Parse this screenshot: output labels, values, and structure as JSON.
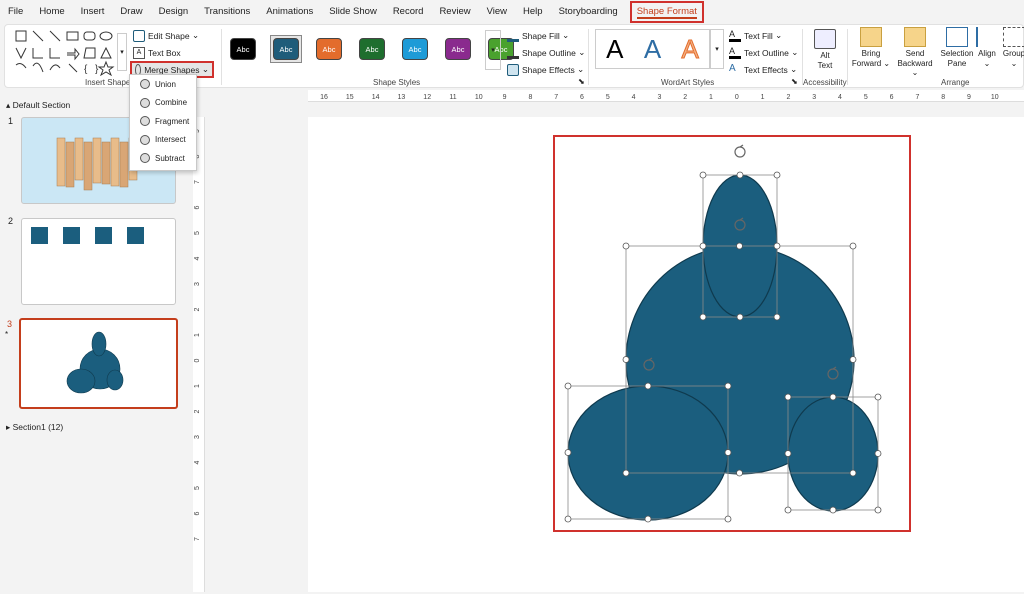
{
  "menu": [
    "File",
    "Home",
    "Insert",
    "Draw",
    "Design",
    "Transitions",
    "Animations",
    "Slide Show",
    "Record",
    "Review",
    "View",
    "Help",
    "Storyboarding",
    "Shape Format"
  ],
  "ribbon": {
    "insert_shapes_label": "Insert Shapes",
    "edit_shape": "Edit Shape",
    "text_box": "Text Box",
    "merge_shapes": "Merge Shapes",
    "shape_styles_label": "Shape Styles",
    "style_text": "Abc",
    "style_colors": [
      "#000000",
      "#1f5c7a",
      "#e36c2c",
      "#1e6e2e",
      "#1e9bd7",
      "#8a2a8e",
      "#4aa22e"
    ],
    "shape_fill": "Shape Fill",
    "shape_outline": "Shape Outline",
    "shape_effects": "Shape Effects",
    "wordart_label": "WordArt Styles",
    "wordart_glyph": "A",
    "text_fill": "Text Fill",
    "text_outline": "Text Outline",
    "text_effects": "Text Effects",
    "alt_text_1": "Alt",
    "alt_text_2": "Text",
    "accessibility_label": "Accessibility",
    "bring_forward_1": "Bring",
    "bring_forward_2": "Forward",
    "send_backward_1": "Send",
    "send_backward_2": "Backward",
    "selection_pane_1": "Selection",
    "selection_pane_2": "Pane",
    "align": "Align",
    "group": "Group",
    "arrange_label": "Arrange"
  },
  "merge_menu": [
    "Union",
    "Combine",
    "Fragment",
    "Intersect",
    "Subtract"
  ],
  "slides_pane": {
    "default_section": "Default Section",
    "section1": "Section1 (12)",
    "slide_numbers": [
      "1",
      "2",
      "3"
    ],
    "star": "*"
  },
  "ruler": {
    "h_ticks": [
      "16",
      "15",
      "14",
      "13",
      "12",
      "11",
      "10",
      "9",
      "8",
      "7",
      "6",
      "5",
      "4",
      "3",
      "2",
      "1",
      "0",
      "1",
      "2",
      "3",
      "4",
      "5",
      "6",
      "7",
      "8",
      "9",
      "10"
    ],
    "v_ticks": [
      "9",
      "8",
      "7",
      "6",
      "5",
      "4",
      "3",
      "2",
      "1",
      "0",
      "1",
      "2",
      "3",
      "4",
      "5",
      "6",
      "7"
    ]
  },
  "colors": {
    "shape_fill": "#1b5e7e",
    "accent": "#c43e1c",
    "highlight": "#d0312d"
  }
}
